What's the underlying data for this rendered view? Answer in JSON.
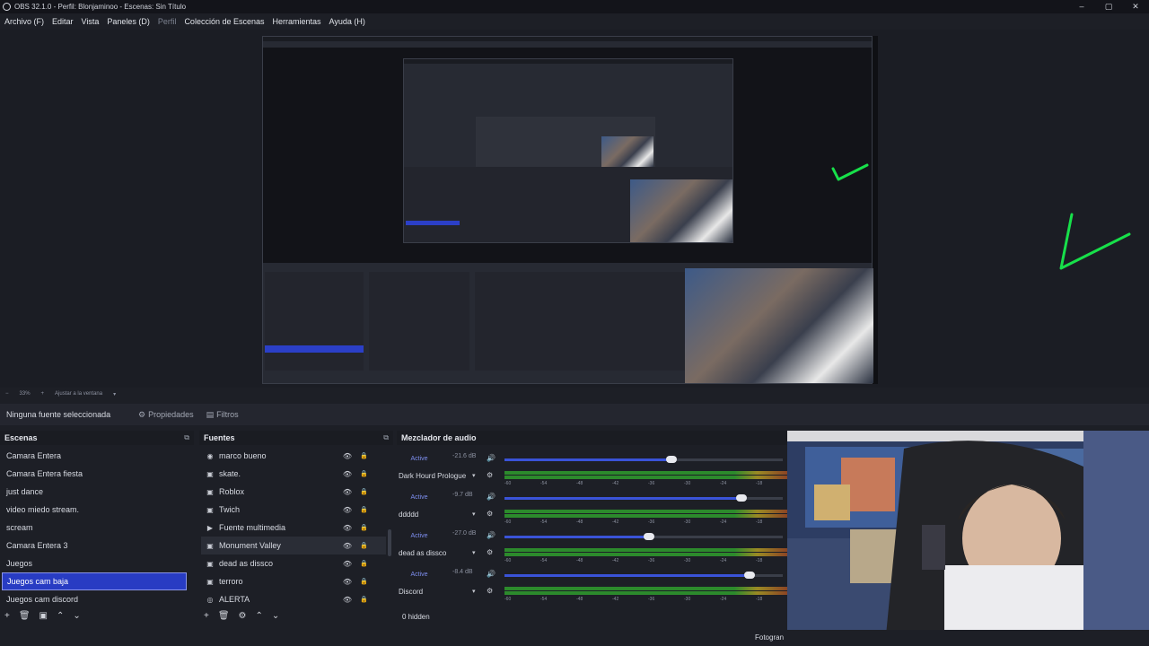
{
  "window": {
    "title": "OBS 32.1.0 - Perfil: Blonjaminoo - Escenas: Sin Título",
    "controls": [
      "–",
      "▢",
      "✕"
    ]
  },
  "menu": [
    {
      "label": "Archivo (F)",
      "enabled": true
    },
    {
      "label": "Editar",
      "enabled": true
    },
    {
      "label": "Vista",
      "enabled": true
    },
    {
      "label": "Paneles (D)",
      "enabled": true
    },
    {
      "label": "Perfil",
      "enabled": false
    },
    {
      "label": "Colección de Escenas",
      "enabled": true
    },
    {
      "label": "Herramientas",
      "enabled": true
    },
    {
      "label": "Ayuda (H)",
      "enabled": true
    }
  ],
  "zoom": {
    "level": "33%",
    "fit_label": "Ajustar a la ventana"
  },
  "properties_bar": {
    "no_selection": "Ninguna fuente seleccionada",
    "properties_label": "Propiedades",
    "filters_label": "Filtros"
  },
  "scenes": {
    "title": "Escenas",
    "items": [
      {
        "label": "Camara Entera",
        "active": false
      },
      {
        "label": "Camara Entera fiesta",
        "active": false
      },
      {
        "label": "just dance",
        "active": false
      },
      {
        "label": "video miedo stream.",
        "active": false
      },
      {
        "label": "scream",
        "active": false
      },
      {
        "label": "Camara Entera 3",
        "active": false
      },
      {
        "label": "Juegos",
        "active": false
      },
      {
        "label": "Juegos cam baja",
        "active": true
      },
      {
        "label": "Juegos cam discord",
        "active": false
      }
    ],
    "footer_icons": [
      "+",
      "🗑",
      "▣",
      "⌃",
      "⌄"
    ]
  },
  "sources": {
    "title": "Fuentes",
    "items": [
      {
        "label": "marco bueno",
        "icon": "image-source-icon"
      },
      {
        "label": "skate.",
        "icon": "game-capture-icon"
      },
      {
        "label": "Roblox",
        "icon": "game-capture-icon"
      },
      {
        "label": "Twich",
        "icon": "game-capture-icon"
      },
      {
        "label": "Fuente multimedia",
        "icon": "media-source-icon"
      },
      {
        "label": "Monument Valley",
        "icon": "game-capture-icon"
      },
      {
        "label": "dead as dissco",
        "icon": "game-capture-icon"
      },
      {
        "label": "terroro",
        "icon": "game-capture-icon"
      },
      {
        "label": "ALERTA",
        "icon": "browser-source-icon"
      }
    ],
    "footer_icons": [
      "+",
      "🗑",
      "⚙",
      "⌃",
      "⌄"
    ]
  },
  "mixer": {
    "title": "Mezclador de audio",
    "hidden_note": "0 hidden",
    "tick_labels": [
      "-60",
      "-54",
      "-48",
      "-42",
      "-36",
      "-30",
      "-24",
      "-18"
    ],
    "channels": [
      {
        "name": "Dark Hourd Prologue",
        "status": "Active",
        "db": "-21.6 dB",
        "volume": 0.6,
        "meter": 1.0
      },
      {
        "name": "ddddd",
        "status": "Active",
        "db": "-9.7 dB",
        "volume": 0.85,
        "meter": 1.0
      },
      {
        "name": "dead as dissco",
        "status": "Active",
        "db": "-27.0 dB",
        "volume": 0.52,
        "meter": 1.0
      },
      {
        "name": "Discord",
        "status": "Active",
        "db": "-8.4 dB",
        "volume": 0.88,
        "meter": 1.0
      }
    ]
  },
  "status": {
    "fps_label": "Fotogran"
  },
  "colors": {
    "accent": "#283cc3",
    "meter_green": "#2c8a2c",
    "neon": "#17e04a"
  }
}
